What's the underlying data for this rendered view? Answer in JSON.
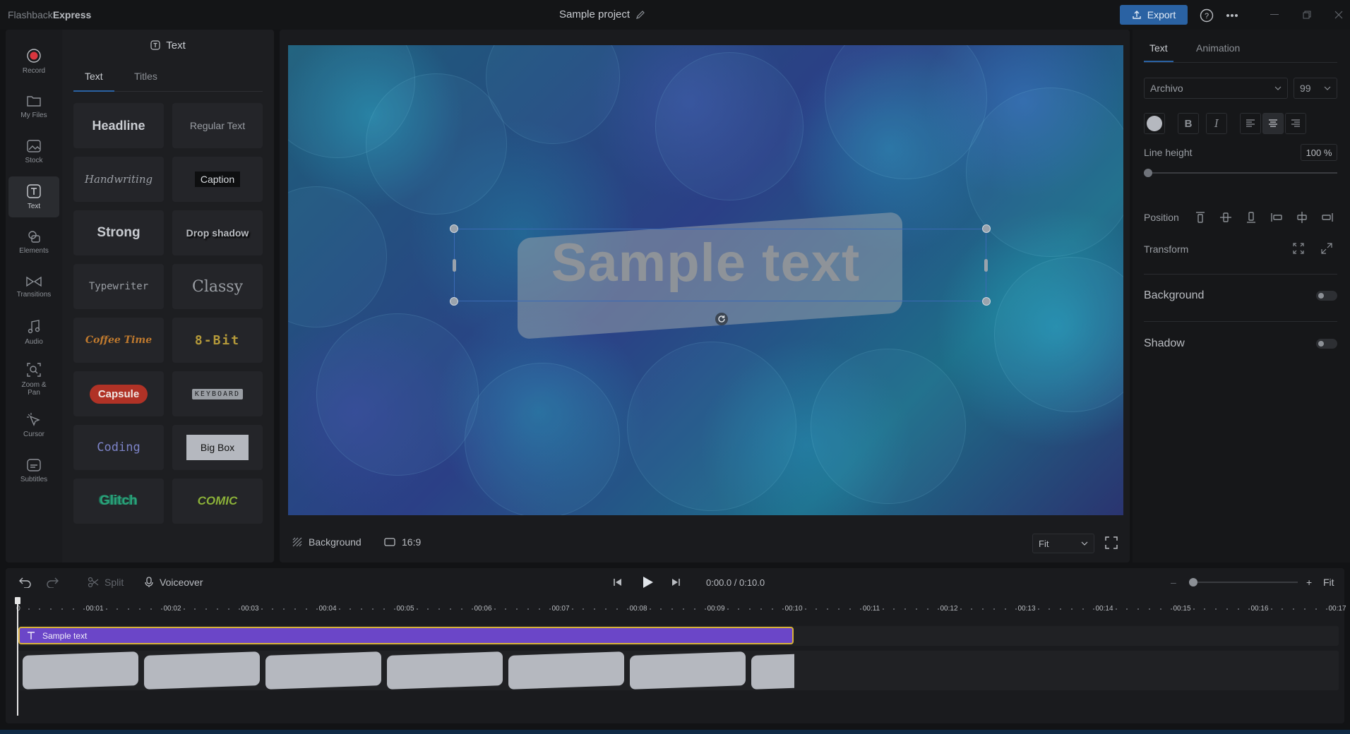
{
  "app": {
    "brand_light": "Flashback",
    "brand_bold": "Express",
    "project_name": "Sample project",
    "export_label": "Export"
  },
  "rail": [
    {
      "label": "Record",
      "icon": "record-icon"
    },
    {
      "label": "My Files",
      "icon": "folder-icon"
    },
    {
      "label": "Stock",
      "icon": "stock-icon"
    },
    {
      "label": "Text",
      "icon": "text-icon"
    },
    {
      "label": "Elements",
      "icon": "elements-icon"
    },
    {
      "label": "Transitions",
      "icon": "transitions-icon"
    },
    {
      "label": "Audio",
      "icon": "audio-icon"
    },
    {
      "label": "Zoom & Pan",
      "icon": "zoom-icon"
    },
    {
      "label": "Cursor",
      "icon": "cursor-icon"
    },
    {
      "label": "Subtitles",
      "icon": "subtitles-icon"
    }
  ],
  "text_panel": {
    "title": "Text",
    "tabs": [
      "Text",
      "Titles"
    ],
    "styles": [
      "Headline",
      "Regular Text",
      "Handwriting",
      "Caption",
      "Strong",
      "Drop shadow",
      "Typewriter",
      "Classy",
      "Coffee Time",
      "8-Bit",
      "Capsule",
      "KEYBOARD",
      "Coding",
      "Big Box",
      "Glitch",
      "COMIC"
    ]
  },
  "preview": {
    "sample_text": "Sample text",
    "background_label": "Background",
    "aspect_label": "16:9",
    "fit_label": "Fit"
  },
  "props": {
    "tabs": [
      "Text",
      "Animation"
    ],
    "font": "Archivo",
    "font_size": "99",
    "line_height_label": "Line height",
    "line_height_value": "100 %",
    "line_height_level": 0.0,
    "position_label": "Position",
    "transform_label": "Transform",
    "background_label": "Background",
    "shadow_label": "Shadow",
    "background_on": false,
    "shadow_on": false
  },
  "timeline": {
    "split_label": "Split",
    "voiceover_label": "Voiceover",
    "time_display": "0:00.0 / 0:10.0",
    "zoom_fit_label": "Fit",
    "ruler": [
      "0",
      "00:01",
      "00:02",
      "00:03",
      "00:04",
      "00:05",
      "00:06",
      "00:07",
      "00:08",
      "00:09",
      "00:10",
      "00:11",
      "00:12",
      "00:13",
      "00:14",
      "00:15",
      "00:16",
      "00:17"
    ],
    "text_clip_label": "Sample text"
  },
  "colors": {
    "accent": "#2a62a3",
    "text_clip": "#6b46c8",
    "clip_border": "#d7b23a",
    "record": "#d9363e"
  }
}
